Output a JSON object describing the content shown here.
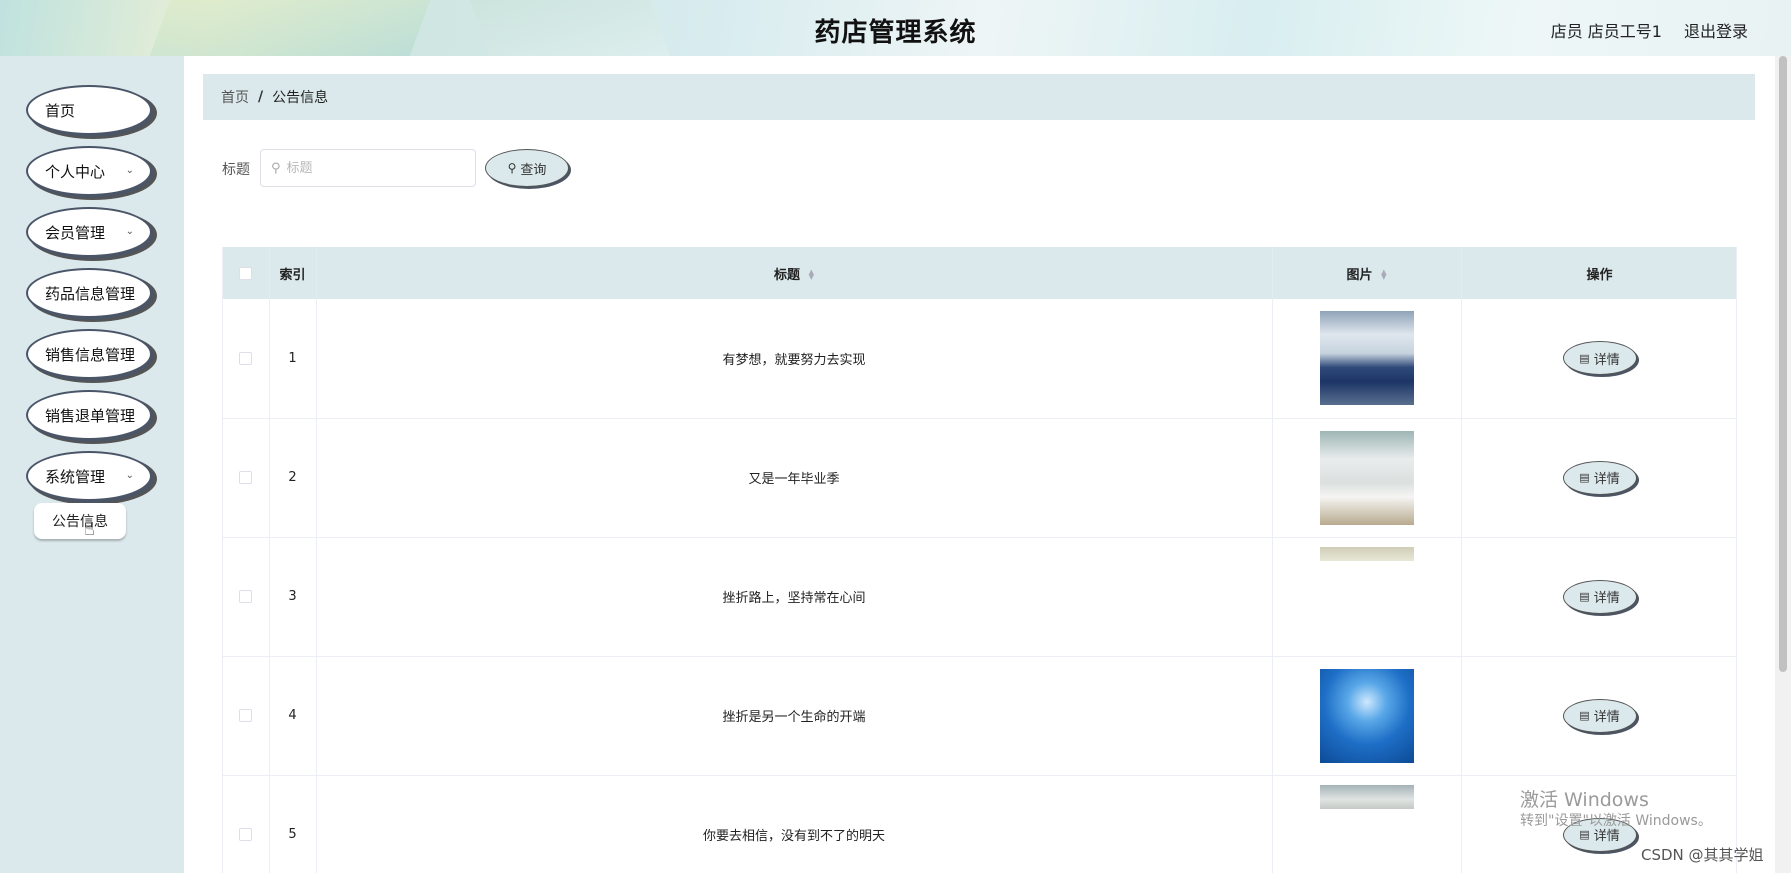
{
  "header": {
    "title": "药店管理系统",
    "user_info": "店员 店员工号1",
    "logout_label": "退出登录"
  },
  "sidebar": {
    "items": [
      {
        "label": "首页",
        "has_submenu": false
      },
      {
        "label": "个人中心",
        "has_submenu": true
      },
      {
        "label": "会员管理",
        "has_submenu": true
      },
      {
        "label": "药品信息管理",
        "has_submenu": false
      },
      {
        "label": "销售信息管理",
        "has_submenu": false
      },
      {
        "label": "销售退单管理",
        "has_submenu": false
      },
      {
        "label": "系统管理",
        "has_submenu": true
      }
    ],
    "submenu_item": "公告信息"
  },
  "breadcrumb": {
    "home": "首页",
    "separator": "/",
    "current": "公告信息"
  },
  "search": {
    "label": "标题",
    "placeholder": "标题",
    "button_label": "查询"
  },
  "table": {
    "headers": {
      "index": "索引",
      "title": "标题",
      "image": "图片",
      "actions": "操作"
    },
    "rows": [
      {
        "index": "1",
        "title": "有梦想，就要努力去实现",
        "image": "hospital-ward-photo"
      },
      {
        "index": "2",
        "title": "又是一年毕业季",
        "image": "hospital-beds-photo"
      },
      {
        "index": "3",
        "title": "挫折路上，坚持常在心间",
        "image": "partial-loaded-photo"
      },
      {
        "index": "4",
        "title": "挫折是另一个生命的开端",
        "image": "operating-room-photo"
      },
      {
        "index": "5",
        "title": "你要去相信，没有到不了的明天",
        "image": "partial-loaded-photo"
      }
    ],
    "detail_label": "详情"
  },
  "watermarks": {
    "windows_line1": "激活 Windows",
    "windows_line2": "转到\"设置\"以激活 Windows。",
    "csdn": "CSDN @其其学姐"
  },
  "colors": {
    "accent_bg": "#dce9ec",
    "button_border": "#4a5568"
  }
}
